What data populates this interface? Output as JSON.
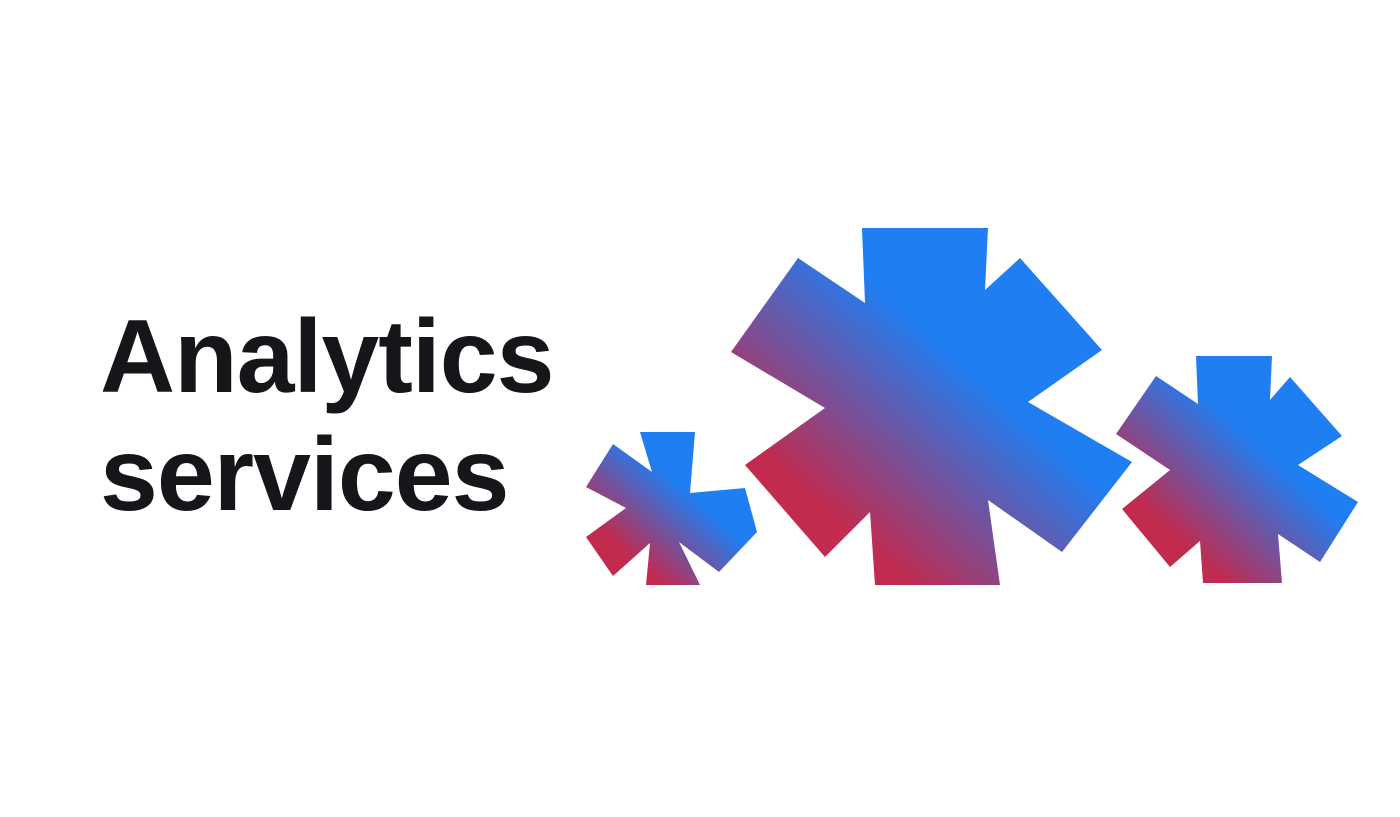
{
  "hero": {
    "title_line_1": "Analytics",
    "title_line_2": "services"
  },
  "decoration": {
    "icon_name": "asterisk-icon",
    "count": 3,
    "gradient_colors": [
      "#c22a4e",
      "#1f7ef2"
    ]
  }
}
